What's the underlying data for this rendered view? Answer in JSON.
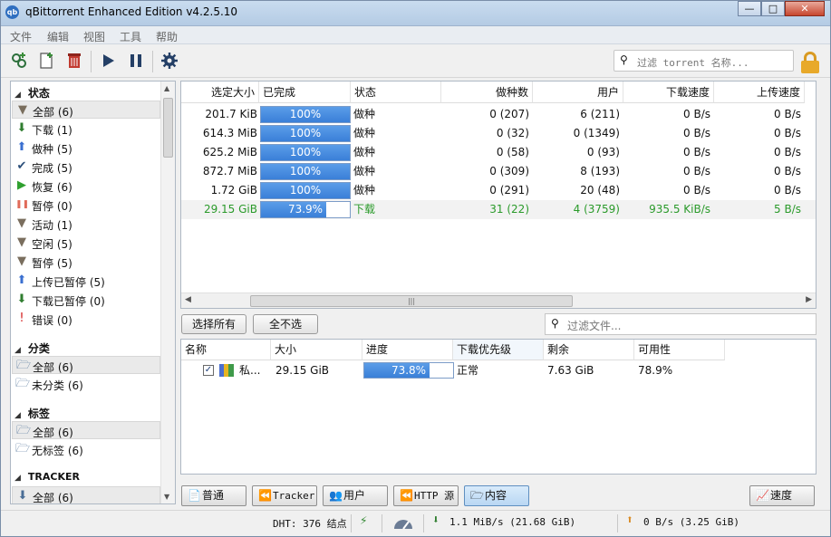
{
  "window": {
    "title": "qBittorrent Enhanced Edition v4.2.5.10",
    "app_icon": "qb",
    "controls": [
      "minimize",
      "maximize",
      "close"
    ]
  },
  "menubar": {
    "items": [
      "文件",
      "编辑",
      "视图",
      "工具",
      "帮助"
    ]
  },
  "toolbar": {
    "buttons": [
      "add-torrent-link-icon",
      "add-torrent-file-icon",
      "delete-icon",
      "resume-icon",
      "pause-icon",
      "options-gear-icon"
    ],
    "search_placeholder": "过滤 torrent 名称...",
    "lock_icon": "lock-icon"
  },
  "sidebar": {
    "status_header": "状态",
    "status_items": [
      {
        "label": "全部 (6)",
        "icon": "filter-icon",
        "selected": true
      },
      {
        "label": "下载 (1)",
        "icon": "arrow-down-icon"
      },
      {
        "label": "做种 (5)",
        "icon": "arrow-up-icon"
      },
      {
        "label": "完成 (5)",
        "icon": "check-icon"
      },
      {
        "label": "恢复 (6)",
        "icon": "play-icon"
      },
      {
        "label": "暂停 (0)",
        "icon": "pause-icon"
      },
      {
        "label": "活动 (1)",
        "icon": "filter-icon"
      },
      {
        "label": "空闲 (5)",
        "icon": "filter-icon"
      },
      {
        "label": "暂停 (5)",
        "icon": "filter-icon"
      },
      {
        "label": "上传已暂停 (5)",
        "icon": "arrow-up-icon"
      },
      {
        "label": "下载已暂停 (0)",
        "icon": "arrow-down-icon"
      },
      {
        "label": "错误 (0)",
        "icon": "error-icon"
      }
    ],
    "category_header": "分类",
    "category_items": [
      {
        "label": "全部 (6)",
        "icon": "folder-icon",
        "selected": true
      },
      {
        "label": "未分类 (6)",
        "icon": "folder-icon"
      }
    ],
    "tag_header": "标签",
    "tag_items": [
      {
        "label": "全部 (6)",
        "icon": "folder-icon",
        "selected": true
      },
      {
        "label": "无标签 (6)",
        "icon": "folder-icon"
      }
    ],
    "tracker_header": "TRACKER",
    "tracker_items": [
      {
        "label": "全部 (6)",
        "icon": "tracker-icon",
        "selected": true
      }
    ]
  },
  "torrents": {
    "columns": [
      "选定大小",
      "已完成",
      "状态",
      "做种数",
      "用户",
      "下载速度",
      "上传速度"
    ],
    "rows": [
      {
        "size": "201.7 KiB",
        "progress": 100,
        "progress_text": "100%",
        "state": "做种",
        "seeds": "0 (207)",
        "peers": "6 (211)",
        "dl": "0 B/s",
        "ul": "0 B/s"
      },
      {
        "size": "614.3 MiB",
        "progress": 100,
        "progress_text": "100%",
        "state": "做种",
        "seeds": "0 (32)",
        "peers": "0 (1349)",
        "dl": "0 B/s",
        "ul": "0 B/s"
      },
      {
        "size": "625.2 MiB",
        "progress": 100,
        "progress_text": "100%",
        "state": "做种",
        "seeds": "0 (58)",
        "peers": "0 (93)",
        "dl": "0 B/s",
        "ul": "0 B/s"
      },
      {
        "size": "872.7 MiB",
        "progress": 100,
        "progress_text": "100%",
        "state": "做种",
        "seeds": "0 (309)",
        "peers": "8 (193)",
        "dl": "0 B/s",
        "ul": "0 B/s"
      },
      {
        "size": "1.72 GiB",
        "progress": 100,
        "progress_text": "100%",
        "state": "做种",
        "seeds": "0 (291)",
        "peers": "20 (48)",
        "dl": "0 B/s",
        "ul": "0 B/s"
      },
      {
        "size": "29.15 GiB",
        "progress": 73.9,
        "progress_text": "73.9%",
        "state": "下载",
        "seeds": "31 (22)",
        "peers": "4 (3759)",
        "dl": "935.5 KiB/s",
        "ul": "5 B/s",
        "downloading": true
      }
    ]
  },
  "file_toolbar": {
    "select_all": "选择所有",
    "select_none": "全不选",
    "filter_placeholder": "过滤文件..."
  },
  "files": {
    "columns": [
      "名称",
      "大小",
      "进度",
      "下载优先级",
      "剩余",
      "可用性"
    ],
    "rows": [
      {
        "checked": true,
        "name": "私...",
        "size": "29.15 GiB",
        "progress": 73.8,
        "progress_text": "73.8%",
        "priority": "正常",
        "remaining": "7.63 GiB",
        "availability": "78.9%"
      }
    ]
  },
  "bottom_tabs": [
    {
      "label": "普通",
      "icon": "info-icon"
    },
    {
      "label": "Tracker",
      "icon": "tracker-icon"
    },
    {
      "label": "用户",
      "icon": "users-icon"
    },
    {
      "label": "HTTP 源",
      "icon": "http-icon"
    },
    {
      "label": "内容",
      "icon": "folder-icon",
      "active": true
    }
  ],
  "speed_button": "速度",
  "statusbar": {
    "dht": "DHT: 376 结点",
    "download": "1.1 MiB/s (21.68 GiB)",
    "upload": "0 B/s (3.25 GiB)"
  },
  "colors": {
    "progress_fill": "#3a7fd8",
    "downloading_text": "#2a9a2a",
    "titlebar": "#c9dcef"
  }
}
